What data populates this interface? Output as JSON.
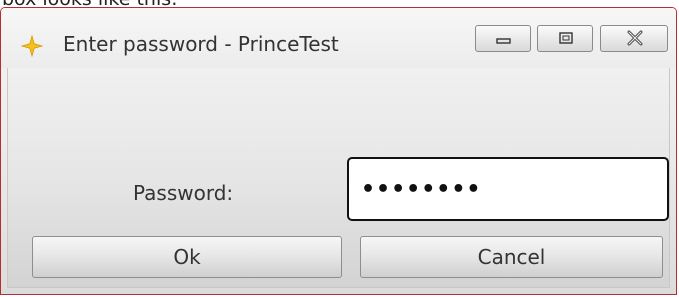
{
  "page_caption": "box looks like this:",
  "window": {
    "title": "Enter password - PrinceTest",
    "icon": "yellow-star-icon",
    "caption_buttons": [
      "minimize-icon",
      "maximize-icon",
      "close-icon"
    ],
    "border_color": "#b32e2e"
  },
  "form": {
    "password_label": "Password:",
    "password_value": "••••••••"
  },
  "buttons": {
    "ok_label": "Ok",
    "cancel_label": "Cancel"
  }
}
